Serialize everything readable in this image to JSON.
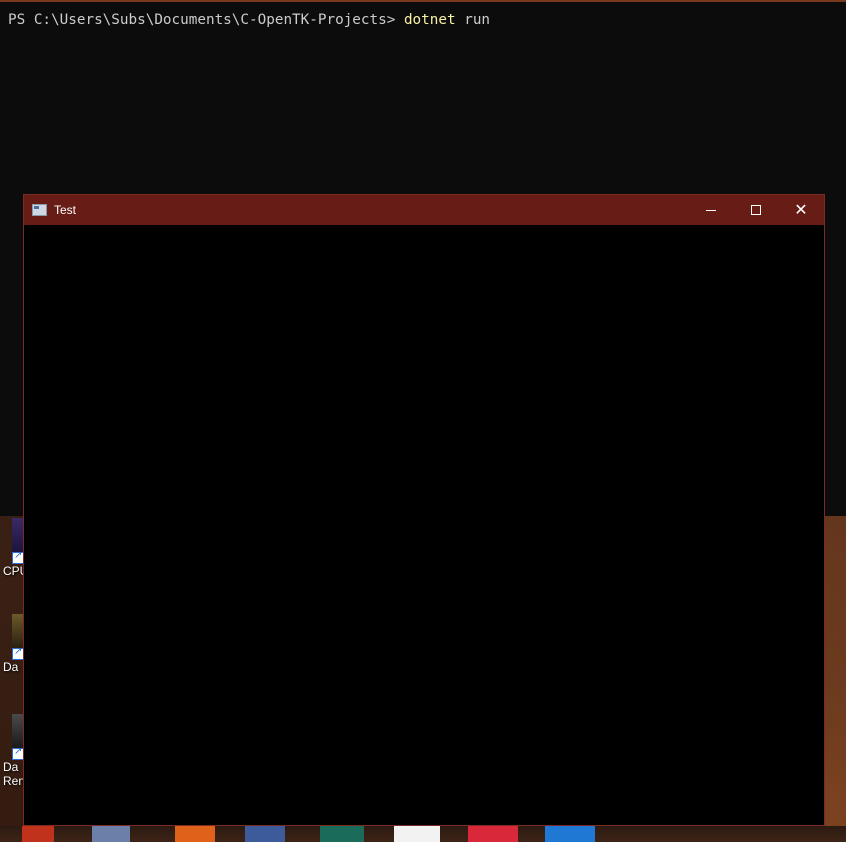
{
  "console": {
    "prompt": "PS C:\\Users\\Subs\\Documents\\C-OpenTK-Projects> ",
    "command": "dotnet",
    "argument": " run"
  },
  "window": {
    "title": "Test",
    "icon": "app-window-icon",
    "controls": {
      "minimize": "minimize-icon",
      "maximize": "maximize-icon",
      "close": "close-icon",
      "close_glyph": "✕"
    }
  },
  "desktop": {
    "icons": [
      {
        "label": "CPU"
      },
      {
        "label": "Da"
      },
      {
        "label": "Da"
      },
      {
        "label": "Ren"
      }
    ]
  },
  "colors": {
    "titlebar": "#671c16",
    "console_bg": "#0c0c0c",
    "command": "#f9f1a5",
    "client_bg": "#000000"
  }
}
